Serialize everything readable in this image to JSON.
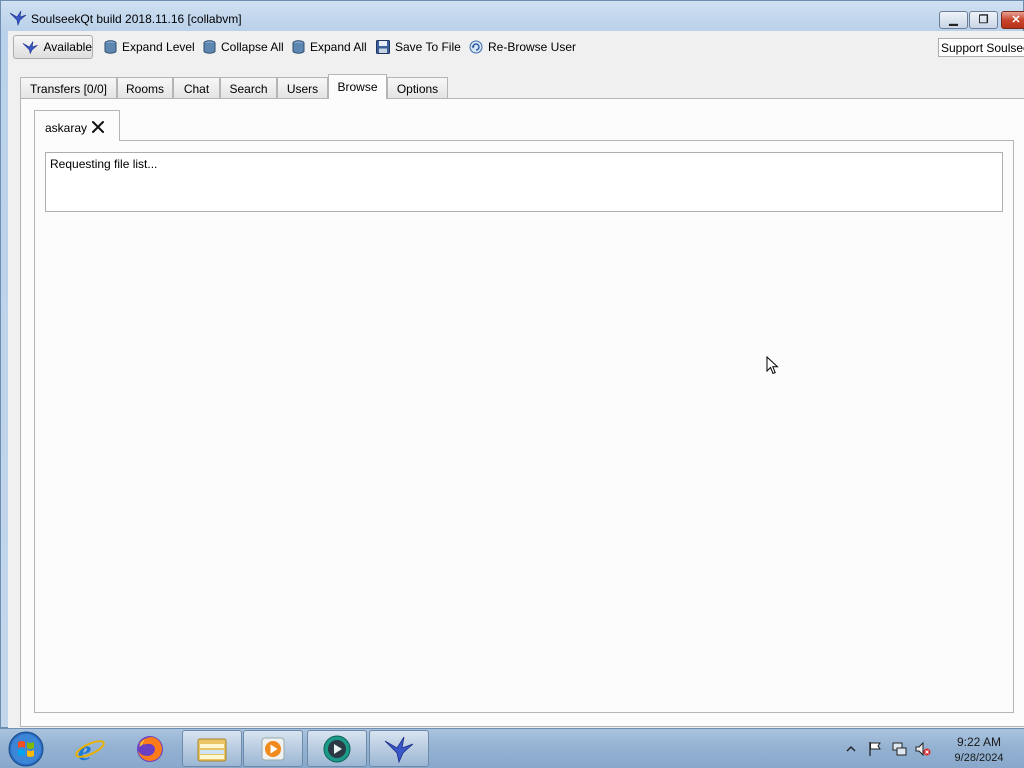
{
  "window": {
    "title": "SoulseekQt build 2018.11.16 [collabvm]",
    "min_glyph": "▁",
    "max_glyph": "❐",
    "close_glyph": "✕"
  },
  "toolbar": {
    "available_label": "Available",
    "expand_level_label": "Expand Level",
    "collapse_all_label": "Collapse All",
    "expand_all_label": "Expand All",
    "save_to_file_label": "Save To File",
    "rebrowse_label": "Re-Browse User",
    "support_label": "Support Soulseek"
  },
  "tabs": [
    {
      "label": "Transfers [0/0]"
    },
    {
      "label": "Rooms"
    },
    {
      "label": "Chat"
    },
    {
      "label": "Search"
    },
    {
      "label": "Users"
    },
    {
      "label": "Browse"
    },
    {
      "label": "Options"
    }
  ],
  "active_tab": "Browse",
  "browse": {
    "user_tab_label": "askaray",
    "status_text": "Requesting file list..."
  },
  "taskbar": {
    "apps": [
      "internet-explorer",
      "firefox",
      "file-explorer",
      "media-player",
      "collabvm-client",
      "soulseekqt"
    ],
    "time": "9:22 AM",
    "date": "9/28/2024"
  },
  "colors": {
    "title_gradient": "#c3d7ec",
    "close_button": "#c9442c",
    "taskbar": "#95b2d2"
  }
}
